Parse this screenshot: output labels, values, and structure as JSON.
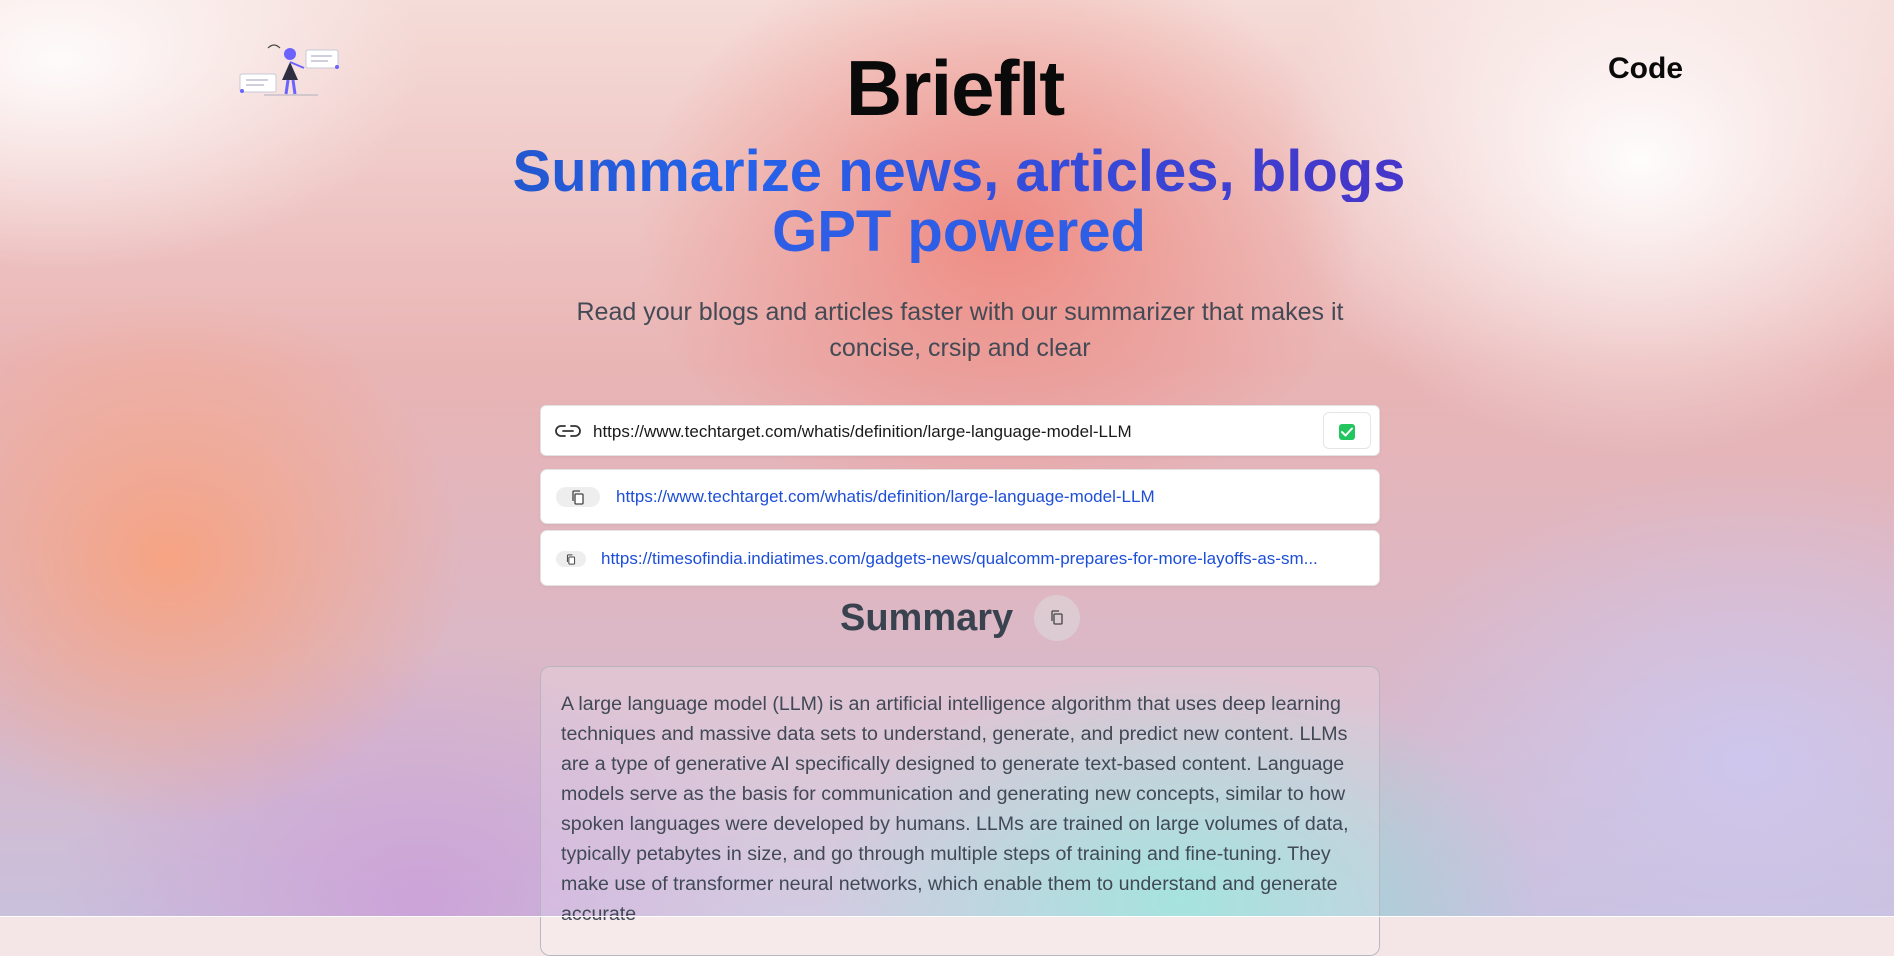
{
  "header": {
    "brand": "BriefIt",
    "code_link": "Code",
    "logo_icon": "reading-person-illustration"
  },
  "hero": {
    "headline_line1": "Summarize news, articles, blogs",
    "headline_line2": "GPT powered",
    "subtitle": "Read your blogs and articles faster with our summarizer that makes it concise, crsip and clear"
  },
  "url_form": {
    "link_icon": "link-icon",
    "value": "https://www.techtarget.com/whatis/definition/large-language-model-LLM",
    "placeholder": "",
    "submit_icon": "check-icon",
    "accent_color": "#22c55e"
  },
  "history": [
    {
      "url": "https://www.techtarget.com/whatis/definition/large-language-model-LLM",
      "icon": "copy-icon"
    },
    {
      "url": "https://timesofindia.indiatimes.com/gadgets-news/qualcomm-prepares-for-more-layoffs-as-sm...",
      "icon": "copy-icon"
    }
  ],
  "summary": {
    "title": "Summary",
    "copy_icon": "copy-icon",
    "text": "A large language model (LLM) is an artificial intelligence algorithm that uses deep learning techniques and massive data sets to understand, generate, and predict new content. LLMs are a type of generative AI specifically designed to generate text-based content. Language models serve as the basis for communication and generating new concepts, similar to how spoken languages were developed by humans. LLMs are trained on large volumes of data, typically petabytes in size, and go through multiple steps of training and fine-tuning. They make use of transformer neural networks, which enable them to understand and generate accurate"
  },
  "colors": {
    "link": "#1d4ed8",
    "headline_start": "#1e3a8a",
    "headline_end": "#6d28d9"
  }
}
